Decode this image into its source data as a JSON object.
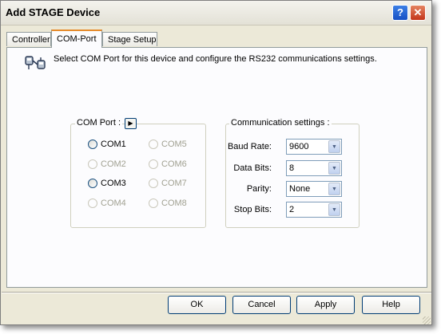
{
  "window": {
    "title": "Add STAGE Device"
  },
  "titlebar_buttons": {
    "help": "?",
    "close": "✕"
  },
  "tabs": [
    {
      "label": "Controller",
      "active": false
    },
    {
      "label": "COM-Port",
      "active": true
    },
    {
      "label": "Stage Setup",
      "active": false
    }
  ],
  "info": {
    "icon": "network-plug-icon",
    "text": "Select COM Port for this device and configure the RS232 communications settings."
  },
  "com_port": {
    "label": "COM Port :",
    "button_glyph": "▶",
    "ports": [
      {
        "label": "COM1",
        "enabled": true
      },
      {
        "label": "COM2",
        "enabled": false
      },
      {
        "label": "COM3",
        "enabled": true
      },
      {
        "label": "COM4",
        "enabled": false
      },
      {
        "label": "COM5",
        "enabled": false
      },
      {
        "label": "COM6",
        "enabled": false
      },
      {
        "label": "COM7",
        "enabled": false
      },
      {
        "label": "COM8",
        "enabled": false
      }
    ]
  },
  "comm": {
    "label": "Communication settings :",
    "fields": [
      {
        "label": "Baud Rate:",
        "accel": "B",
        "value": "9600"
      },
      {
        "label": "Data Bits:",
        "accel": "D",
        "value": "8"
      },
      {
        "label": "Parity:",
        "accel": "r",
        "value": "None"
      },
      {
        "label": "Stop Bits:",
        "accel": "S",
        "value": "2"
      }
    ],
    "dropdown_glyph": "▼"
  },
  "buttons": {
    "ok": "OK",
    "cancel": "Cancel",
    "apply": "Apply",
    "help": "Help"
  },
  "colors": {
    "tab_highlight": "#e68b2c",
    "disabled_text": "#a1a192",
    "dialog_face": "#ece9d8"
  }
}
